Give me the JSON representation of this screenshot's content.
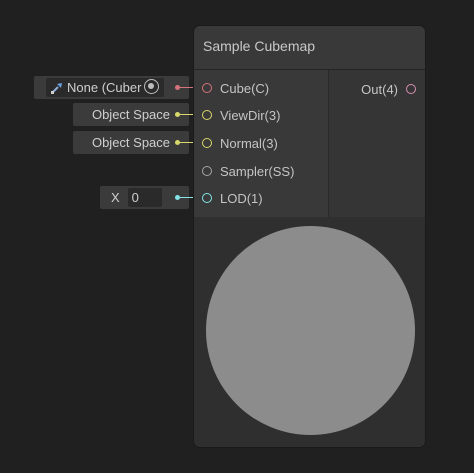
{
  "node": {
    "title": "Sample Cubemap",
    "inputs": [
      {
        "label": "Cube(C)",
        "color": "#d6727c"
      },
      {
        "label": "ViewDir(3)",
        "color": "#d8d86a"
      },
      {
        "label": "Normal(3)",
        "color": "#d8d86a"
      },
      {
        "label": "Sampler(SS)",
        "color": "#a5a5a5"
      },
      {
        "label": "LOD(1)",
        "color": "#84e4e7"
      }
    ],
    "output": {
      "label": "Out(4)",
      "color": "#d98fb4"
    }
  },
  "fields": {
    "cube_value": "None (Cuber",
    "viewdir_value": "Object Space",
    "normal_value": "Object Space",
    "lod_prefix": "X",
    "lod_value": "0"
  },
  "icons": {
    "cube_asset": "cubemap-icon",
    "object_picker": "object-picker-icon"
  },
  "colors": {
    "background": "#202020",
    "node_header": "#393939",
    "preview_sphere": "#8c8c8c"
  }
}
